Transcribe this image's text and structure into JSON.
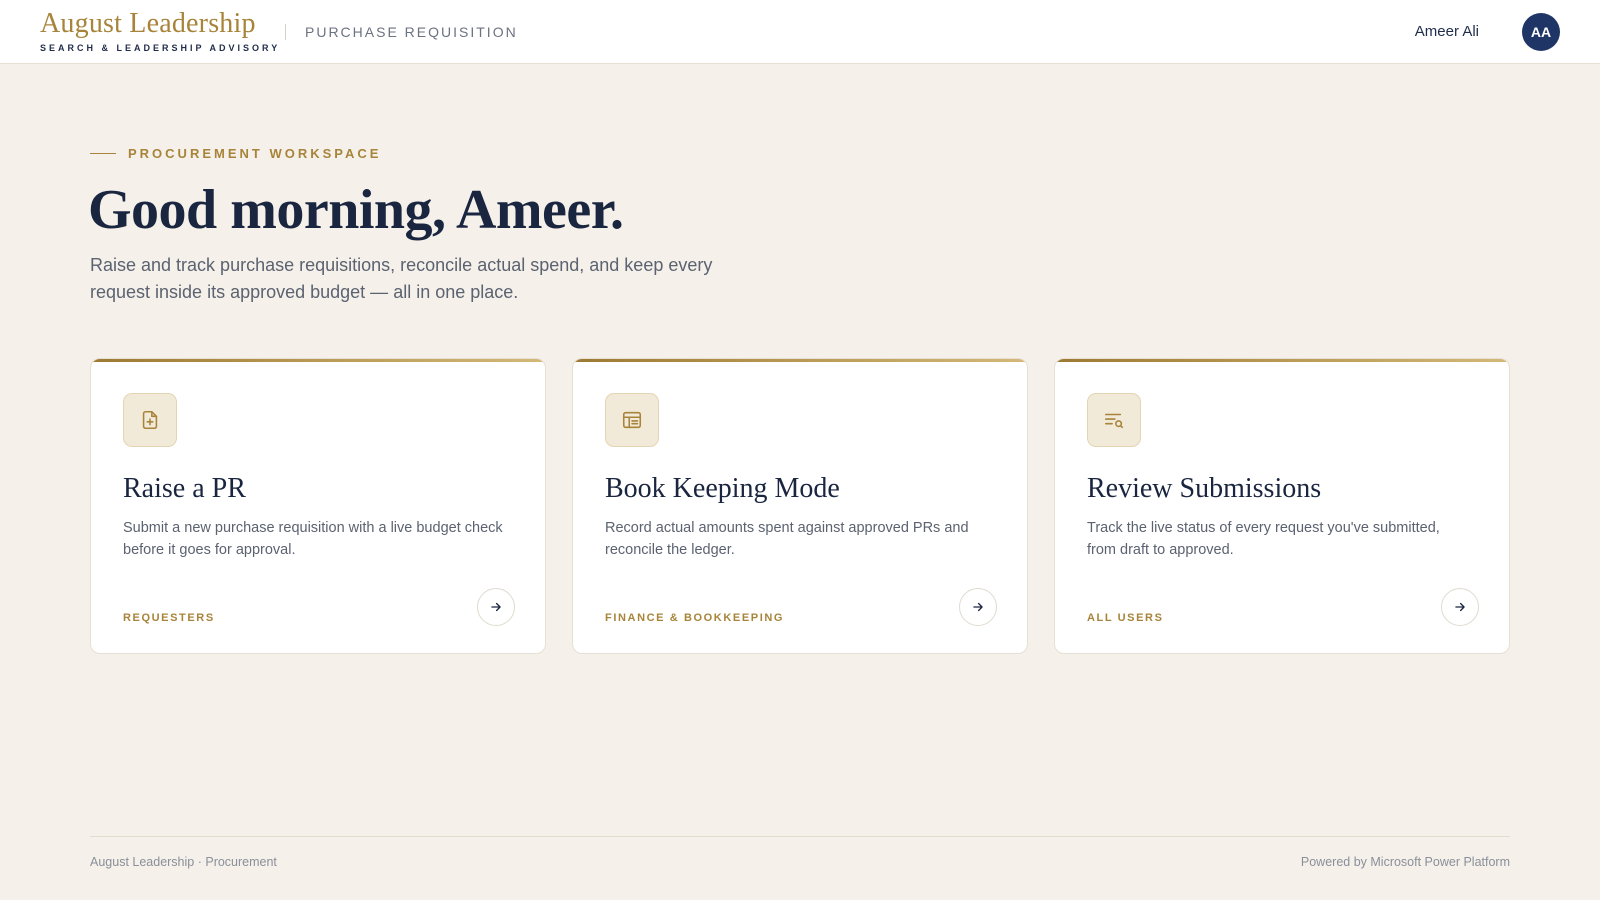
{
  "header": {
    "brand_name": "August Leadership",
    "brand_tagline": "SEARCH & LEADERSHIP ADVISORY",
    "module_title": "PURCHASE REQUISITION",
    "user_name": "Ameer Ali",
    "user_initials": "AA"
  },
  "hero": {
    "eyebrow": "PROCUREMENT WORKSPACE",
    "greeting": "Good morning, Ameer.",
    "intro": "Raise and track purchase requisitions, reconcile actual spend, and keep every request inside its approved budget — all in one place."
  },
  "cards": [
    {
      "icon": "file-plus-icon",
      "title": "Raise a PR",
      "description": "Submit a new purchase requisition with a live budget check before it goes for approval.",
      "audience": "REQUESTERS"
    },
    {
      "icon": "ledger-icon",
      "title": "Book Keeping Mode",
      "description": "Record actual amounts spent against approved PRs and reconcile the ledger.",
      "audience": "FINANCE & BOOKKEEPING"
    },
    {
      "icon": "list-search-icon",
      "title": "Review Submissions",
      "description": "Track the live status of every request you've submitted, from draft to approved.",
      "audience": "ALL USERS"
    }
  ],
  "footer": {
    "left": "August Leadership · Procurement",
    "right": "Powered by Microsoft Power Platform"
  },
  "colors": {
    "accent_gold": "#a8843a",
    "navy": "#1f3566",
    "background": "#f5f1ea"
  }
}
